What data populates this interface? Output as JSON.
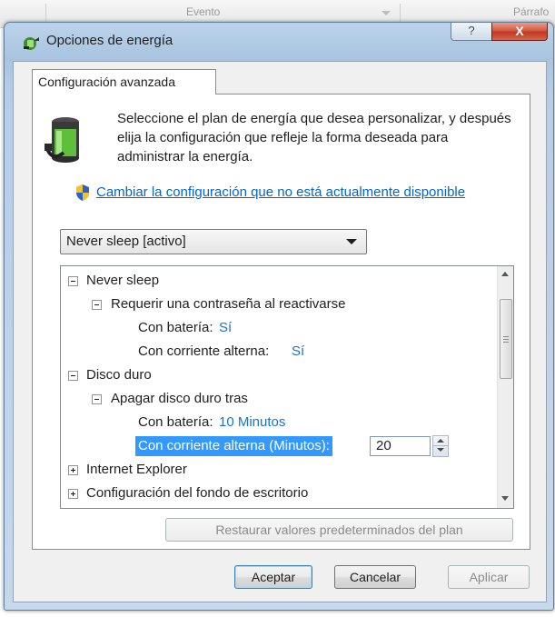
{
  "background": {
    "col1": "Evento",
    "col2": "Párrafo"
  },
  "window": {
    "title": "Opciones de energía",
    "help": "?",
    "close": "X"
  },
  "tab": {
    "label": "Configuración avanzada"
  },
  "description": "Seleccione el plan de energía que desea personalizar, y después elija la configuración que refleje la forma deseada para administrar la energía.",
  "change_link": "Cambiar la configuración que no está actualmente disponible",
  "plan_select": {
    "value": "Never sleep [activo]"
  },
  "tree": {
    "n1": "Never sleep",
    "n1_1": "Requerir una contraseña al reactivarse",
    "n1_1_bat_label": "Con batería:",
    "n1_1_bat_value": "Sí",
    "n1_1_ac_label": "Con corriente alterna:",
    "n1_1_ac_value": "Sí",
    "n2": "Disco duro",
    "n2_1": "Apagar disco duro tras",
    "n2_1_bat_label": "Con batería:",
    "n2_1_bat_value": "10 Minutos",
    "n2_1_ac_label": "Con corriente alterna (Minutos):",
    "n2_1_ac_value": "20",
    "n3": "Internet Explorer",
    "n4": "Configuración del fondo de escritorio"
  },
  "buttons": {
    "restore": "Restaurar valores predeterminados del plan",
    "ok": "Aceptar",
    "cancel": "Cancelar",
    "apply": "Aplicar"
  }
}
